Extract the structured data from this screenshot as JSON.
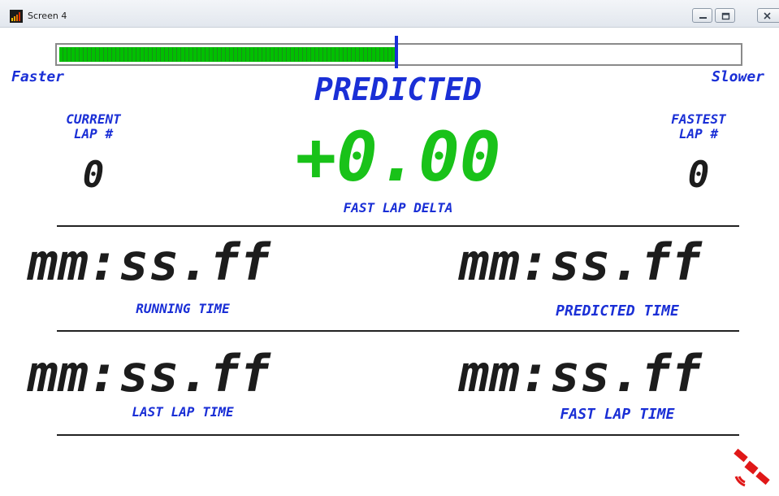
{
  "window": {
    "title": "Screen 4"
  },
  "delta_bar": {
    "fill_fraction": 0.497,
    "left_label": "Faster",
    "right_label": "Slower",
    "fill_color": "#00c000",
    "marker_color": "#1a2fd6"
  },
  "header": {
    "mode_label": "PREDICTED"
  },
  "current_lap": {
    "label_line1": "CURRENT",
    "label_line2": "LAP #",
    "value": "0"
  },
  "fastest_lap": {
    "label_line1": "FASTEST",
    "label_line2": "LAP #",
    "value": "0"
  },
  "delta": {
    "value": "+0.00",
    "label": "FAST LAP DELTA",
    "color": "#19c219"
  },
  "times": {
    "running": {
      "value": "mm:ss.ff",
      "label": "RUNNING TIME"
    },
    "predicted": {
      "value": "mm:ss.ff",
      "label": "PREDICTED TIME"
    },
    "last_lap": {
      "value": "mm:ss.ff",
      "label": "LAST LAP TIME"
    },
    "fast_lap": {
      "value": "mm:ss.ff",
      "label": "FAST LAP TIME"
    }
  },
  "icons": {
    "app": "app-bar-chart-icon",
    "gps": "satellite-icon",
    "minimize": "minimize-icon",
    "maximize": "maximize-icon",
    "close": "close-icon"
  },
  "colors": {
    "label_blue": "#1a2fd6",
    "delta_green": "#19c219",
    "gps_red": "#e01818"
  }
}
